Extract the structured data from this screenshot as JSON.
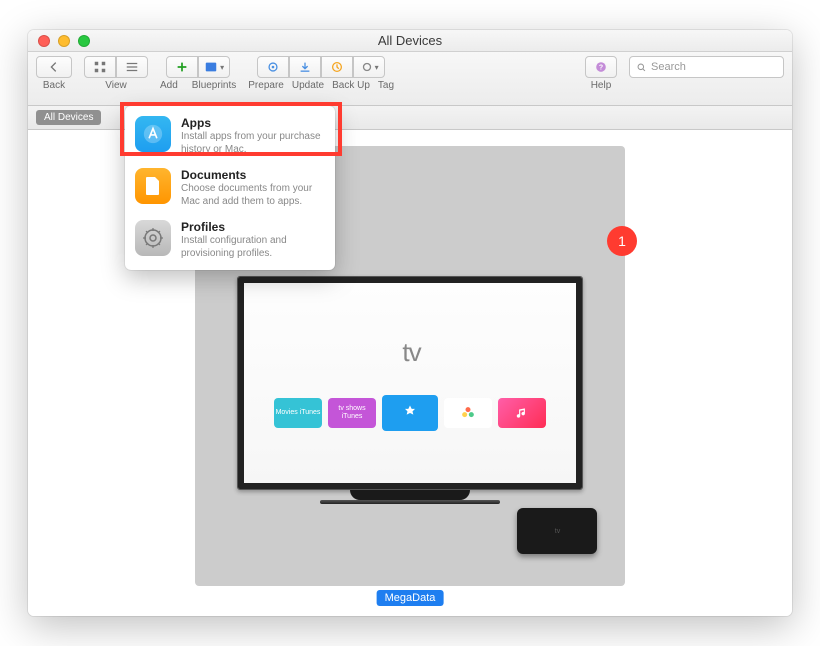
{
  "window": {
    "title": "All Devices"
  },
  "toolbar": {
    "back_label": "Back",
    "view_label": "View",
    "add_label": "Add",
    "blueprints_label": "Blueprints",
    "prepare_label": "Prepare",
    "update_label": "Update",
    "backup_label": "Back Up",
    "tag_label": "Tag",
    "help_label": "Help",
    "search_placeholder": "Search"
  },
  "breadcrumb": {
    "item0": "All Devices"
  },
  "dropdown": {
    "items": [
      {
        "title": "Apps",
        "subtitle": "Install apps from your purchase history or Mac."
      },
      {
        "title": "Documents",
        "subtitle": "Choose documents from your Mac and add them to apps."
      },
      {
        "title": "Profiles",
        "subtitle": "Install configuration and provisioning profiles."
      }
    ]
  },
  "device": {
    "badge_count": "1",
    "label": "MegaData",
    "logo_text": "tv",
    "apps": [
      {
        "label": "Movies\niTunes",
        "color": "#35c3d6"
      },
      {
        "label": "tv shows\niTunes",
        "color": "#c455d8"
      },
      {
        "label": "App Store",
        "color": "#1e9ef0"
      },
      {
        "label": "Photos",
        "color": "#ffffff"
      },
      {
        "label": "Music",
        "color": "#ff2d92"
      }
    ]
  },
  "colors": {
    "accent": "#1e7ef0",
    "badge": "#ff3b30"
  }
}
